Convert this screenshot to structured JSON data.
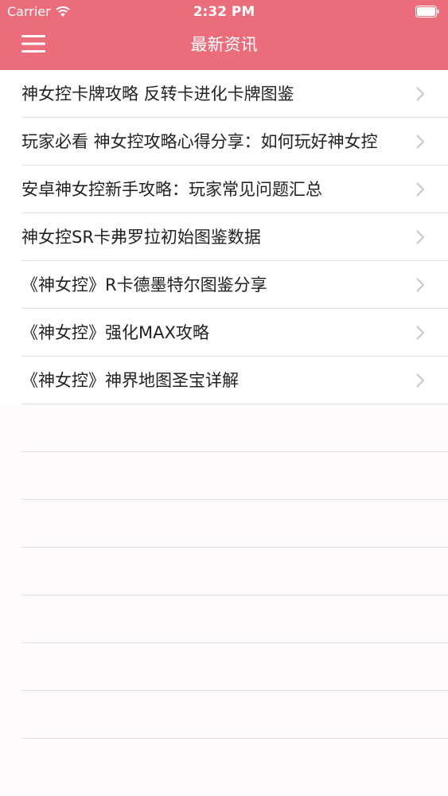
{
  "status_bar": {
    "carrier": "Carrier",
    "time": "2:32 PM"
  },
  "nav": {
    "title": "最新资讯",
    "menu_icon": "hamburger-menu-icon"
  },
  "articles": [
    {
      "title": "神女控卡牌攻略 反转卡进化卡牌图鉴"
    },
    {
      "title": "玩家必看 神女控攻略心得分享：如何玩好神女控"
    },
    {
      "title": "安卓神女控新手攻略：玩家常见问题汇总"
    },
    {
      "title": "神女控SR卡弗罗拉初始图鉴数据"
    },
    {
      "title": "《神女控》R卡德墨特尔图鉴分享"
    },
    {
      "title": "《神女控》强化MAX攻略"
    },
    {
      "title": "《神女控》神界地图圣宝详解"
    }
  ],
  "colors": {
    "header": "#eb6c7b",
    "separator": "#e3dfe0",
    "chevron": "#c7c7cc"
  }
}
